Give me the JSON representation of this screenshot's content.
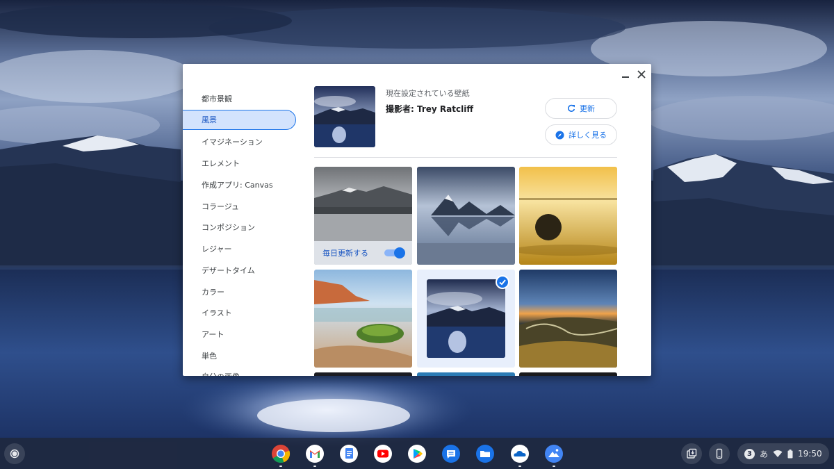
{
  "window": {
    "controls": {
      "minimize_icon": "minimize-icon",
      "close_icon": "close-icon"
    }
  },
  "sidebar": {
    "items": [
      {
        "label": "都市景観",
        "selected": false
      },
      {
        "label": "風景",
        "selected": true
      },
      {
        "label": "イマジネーション",
        "selected": false
      },
      {
        "label": "エレメント",
        "selected": false
      },
      {
        "label": "作成アプリ: Canvas",
        "selected": false
      },
      {
        "label": "コラージュ",
        "selected": false
      },
      {
        "label": "コンポジション",
        "selected": false
      },
      {
        "label": "レジャー",
        "selected": false
      },
      {
        "label": "デザートタイム",
        "selected": false
      },
      {
        "label": "カラー",
        "selected": false
      },
      {
        "label": "イラスト",
        "selected": false
      },
      {
        "label": "アート",
        "selected": false
      },
      {
        "label": "単色",
        "selected": false
      },
      {
        "label": "自分の画像",
        "selected": false
      }
    ]
  },
  "current": {
    "caption": "現在設定されている壁紙",
    "author": "撮影者: Trey Ratcliff",
    "refresh_label": "更新",
    "details_label": "詳しく見る"
  },
  "grid": {
    "daily_refresh_label": "毎日更新する",
    "daily_refresh_on": true,
    "tiles": [
      {
        "name": "misty-lake-mountains",
        "selected": false
      },
      {
        "name": "rocky-mountain-reflection",
        "selected": false
      },
      {
        "name": "golden-sunset-beach",
        "selected": false
      },
      {
        "name": "mossy-rock-coast",
        "selected": false
      },
      {
        "name": "night-lake-mountains",
        "selected": true
      },
      {
        "name": "valley-sunset",
        "selected": false
      }
    ]
  },
  "shelf": {
    "apps": [
      "chrome-icon",
      "gmail-icon",
      "docs-icon",
      "youtube-icon",
      "play-store-icon",
      "messages-icon",
      "files-icon",
      "onedrive-icon",
      "wallpaper-app-icon"
    ],
    "notification_count": "3",
    "ime_label": "あ",
    "time": "19:50"
  },
  "colors": {
    "accent": "#1a73e8",
    "selected_bg": "#d3e3fd"
  }
}
